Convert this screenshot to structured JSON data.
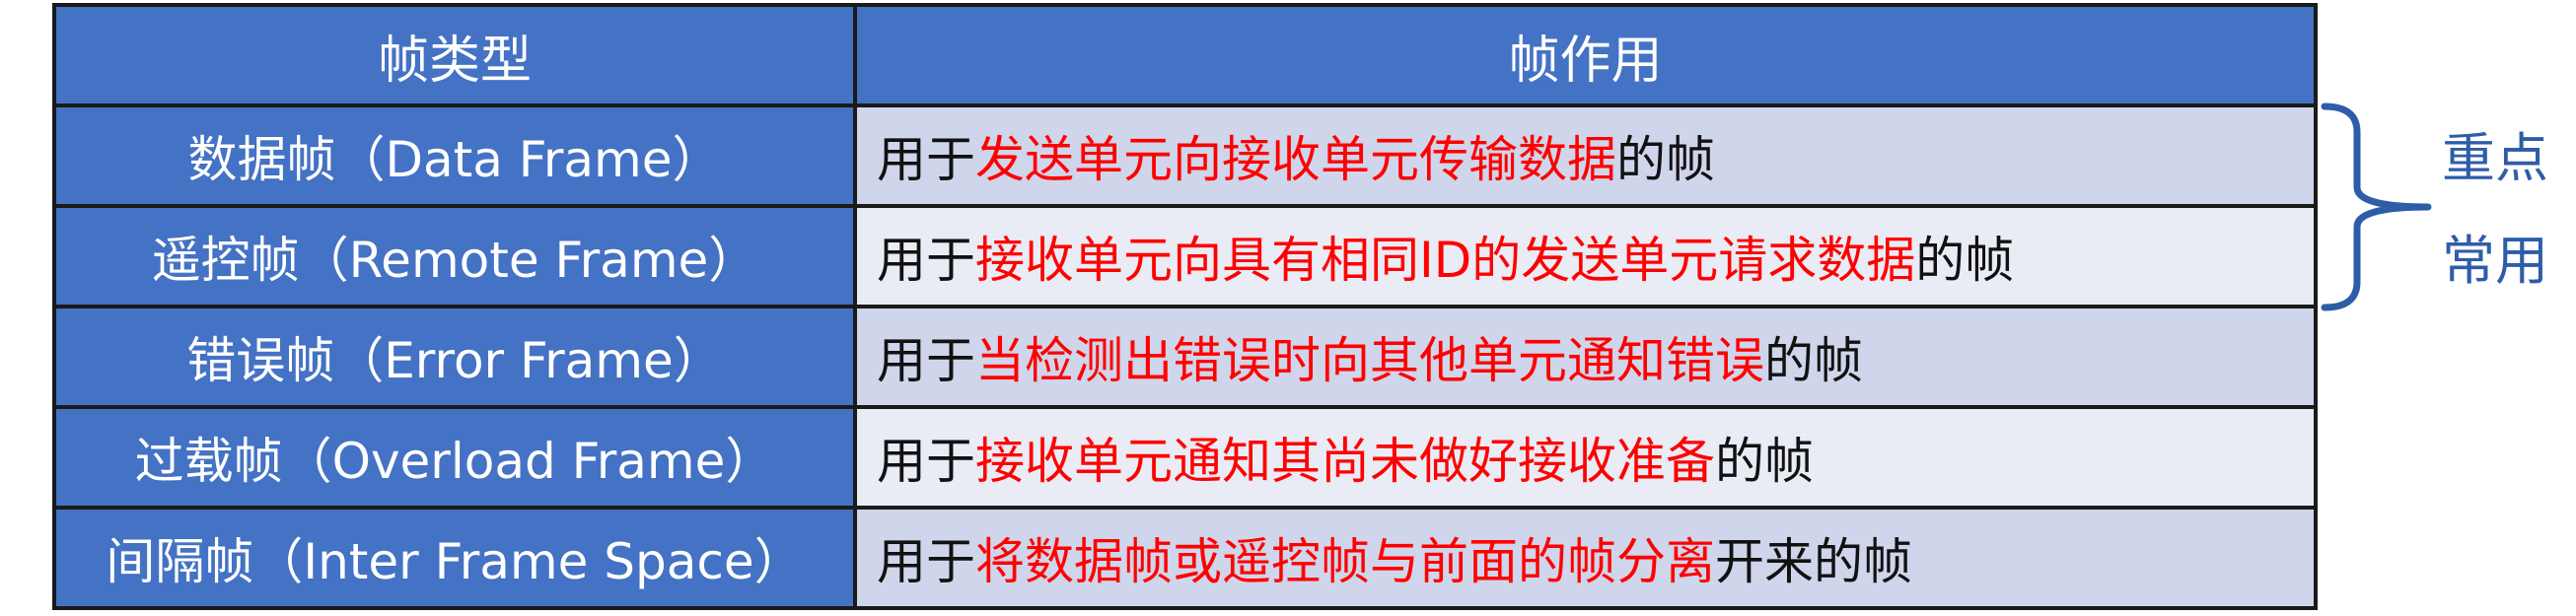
{
  "table": {
    "headers": [
      "帧类型",
      "帧作用"
    ],
    "rows": [
      {
        "type": "数据帧（Data Frame）",
        "desc_pre": "用于",
        "desc_hl": "发送单元向接收单元传输数据",
        "desc_post": "的帧"
      },
      {
        "type": "遥控帧（Remote Frame）",
        "desc_pre": "用于",
        "desc_hl": "接收单元向具有相同ID的发送单元请求数据",
        "desc_post": "的帧"
      },
      {
        "type": "错误帧（Error Frame）",
        "desc_pre": "用于",
        "desc_hl": "当检测出错误时向其他单元通知错误",
        "desc_post": "的帧"
      },
      {
        "type": "过载帧（Overload Frame）",
        "desc_pre": "用于",
        "desc_hl": "接收单元通知其尚未做好接收准备",
        "desc_post": "的帧"
      },
      {
        "type": "间隔帧（Inter Frame Space）",
        "desc_pre": "用于",
        "desc_hl": "将数据帧或遥控帧与前面的帧分离",
        "desc_post": "开来的帧"
      }
    ]
  },
  "annotation": {
    "line1": "重点",
    "line2": "常用"
  },
  "colors": {
    "header_bg": "#4472c4",
    "row_bg_dark": "#cfd5ea",
    "row_bg_light": "#e9ebf5",
    "highlight_text": "#ff0000",
    "annotation": "#2e5da8"
  }
}
